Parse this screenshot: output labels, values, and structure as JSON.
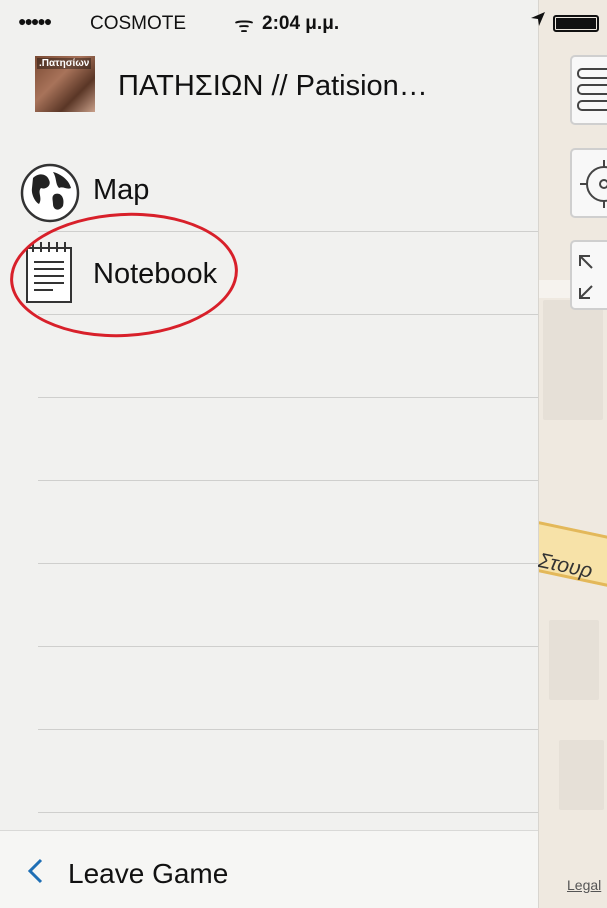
{
  "status_bar": {
    "signal": "●●●●●",
    "carrier": "COSMOTE",
    "wifi": "ᯤ",
    "time": "2:04 μ.μ.",
    "location_icon": "location-arrow-icon",
    "battery_icon": "battery-icon"
  },
  "header": {
    "thumbnail_text": ".Πατησίων",
    "title": "ΠΑΤΗΣΙΩΝ // Patision…"
  },
  "menu": {
    "items": [
      {
        "label": "Map",
        "icon": "globe-icon"
      },
      {
        "label": "Notebook",
        "icon": "notebook-icon"
      }
    ]
  },
  "footer": {
    "back_icon": "chevron-left-icon",
    "label": "Leave Game"
  },
  "map": {
    "street_label": "Στουρ",
    "legal_link": "Legal"
  },
  "colors": {
    "drawer_bg": "#f1f1ef",
    "annotation": "#d8202a",
    "back_chevron": "#1f6fb5"
  }
}
